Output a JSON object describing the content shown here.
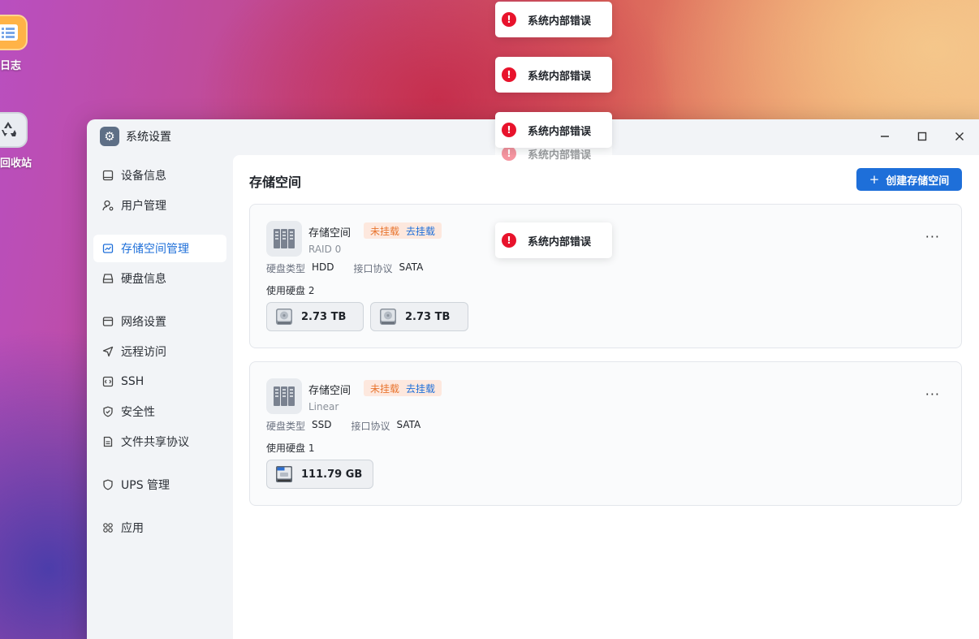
{
  "desktop": {
    "icons": [
      {
        "label": "日志"
      },
      {
        "label": "回收站"
      }
    ]
  },
  "window": {
    "title": "系统设置",
    "controls": {
      "minimize": "—",
      "maximize": "☐",
      "close": "✕"
    }
  },
  "sidebar": {
    "items": [
      {
        "label": "设备信息",
        "icon": "device-icon"
      },
      {
        "label": "用户管理",
        "icon": "user-icon"
      },
      {
        "label": "存储空间管理",
        "icon": "storage-icon",
        "active": true
      },
      {
        "label": "硬盘信息",
        "icon": "disk-icon"
      },
      {
        "label": "网络设置",
        "icon": "network-icon"
      },
      {
        "label": "远程访问",
        "icon": "send-icon"
      },
      {
        "label": "SSH",
        "icon": "code-icon"
      },
      {
        "label": "安全性",
        "icon": "shield-check-icon"
      },
      {
        "label": "文件共享协议",
        "icon": "document-icon"
      },
      {
        "label": "UPS 管理",
        "icon": "shield-icon"
      },
      {
        "label": "应用",
        "icon": "apps-icon"
      }
    ]
  },
  "main": {
    "title": "存储空间",
    "create_button": {
      "plus": "+",
      "label": "创建存储空间"
    },
    "pools": [
      {
        "name": "存储空间",
        "status": "未挂载",
        "action": "去挂载",
        "raid": "RAID 0",
        "disk_type_label": "硬盘类型",
        "disk_type": "HDD",
        "interface_label": "接口协议",
        "interface": "SATA",
        "used_label": "使用硬盘 2",
        "disks": [
          "2.73 TB",
          "2.73 TB"
        ],
        "more": "···"
      },
      {
        "name": "存储空间",
        "status": "未挂载",
        "action": "去挂载",
        "raid": "Linear",
        "disk_type_label": "硬盘类型",
        "disk_type": "SSD",
        "interface_label": "接口协议",
        "interface": "SATA",
        "used_label": "使用硬盘 1",
        "disks": [
          "111.79 GB"
        ],
        "more": "···"
      }
    ]
  },
  "toasts": [
    {
      "text": "系统内部错误",
      "icon": "error-icon"
    },
    {
      "text": "系统内部错误",
      "icon": "error-icon"
    },
    {
      "text": "系统内部错误",
      "icon": "error-icon"
    },
    {
      "text": "系统内部错误",
      "icon": "error-icon"
    },
    {
      "text": "系统内部错误",
      "icon": "error-icon"
    }
  ],
  "colors": {
    "accent": "#1e6fd9",
    "error": "#e8132c",
    "warning": "#e8752f"
  }
}
